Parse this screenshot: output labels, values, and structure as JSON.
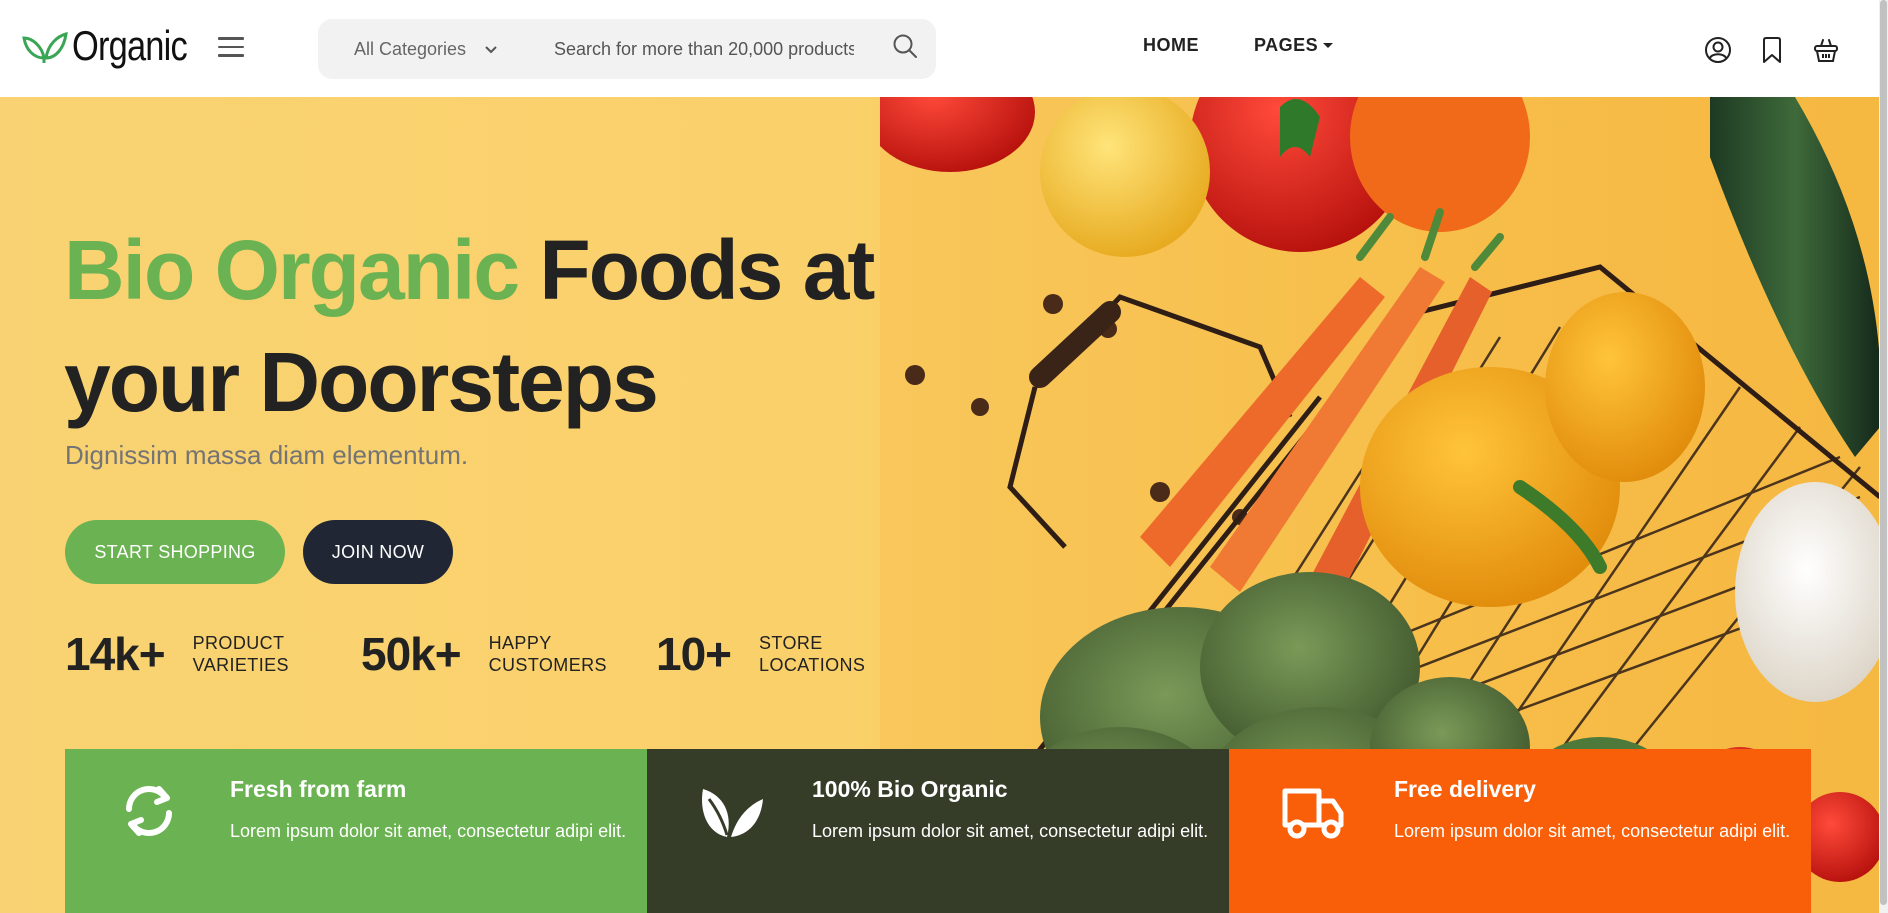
{
  "header": {
    "logo_text": "Organic",
    "search": {
      "category": "All Categories",
      "placeholder": "Search for more than 20,000 products"
    },
    "nav": {
      "home": "HOME",
      "pages": "PAGES"
    },
    "icons": [
      "user-icon",
      "bookmark-icon",
      "basket-icon"
    ]
  },
  "hero": {
    "title_green": "Bio Organic",
    "title_rest": " Foods at",
    "title_line2_light": "your ",
    "title_line2_bold": "Doorsteps",
    "subtitle": "Dignissim massa diam elementum.",
    "buttons": {
      "start_shopping": "START SHOPPING",
      "join_now": "JOIN NOW"
    },
    "stats": [
      {
        "number": "14k+",
        "label_line1": "PRODUCT",
        "label_line2": "VARIETIES"
      },
      {
        "number": "50k+",
        "label_line1": "HAPPY",
        "label_line2": "CUSTOMERS"
      },
      {
        "number": "10+",
        "label_line1": "STORE",
        "label_line2": "LOCATIONS"
      }
    ]
  },
  "features": [
    {
      "title": "Fresh from farm",
      "text": "Lorem ipsum dolor sit amet, consectetur adipi elit.",
      "icon": "refresh-icon",
      "color": "#6bb252"
    },
    {
      "title": "100% Bio Organic",
      "text": "Lorem ipsum dolor sit amet, consectetur adipi elit.",
      "icon": "leaf-icon",
      "color": "#353d29"
    },
    {
      "title": "Free delivery",
      "text": "Lorem ipsum dolor sit amet, consectetur adipi elit.",
      "icon": "truck-icon",
      "color": "#f95f09"
    }
  ],
  "colors": {
    "brand_green": "#6bb252",
    "dark": "#202634",
    "hero_bg": "#f9d373",
    "orange": "#f95f09",
    "olive": "#353d29"
  }
}
